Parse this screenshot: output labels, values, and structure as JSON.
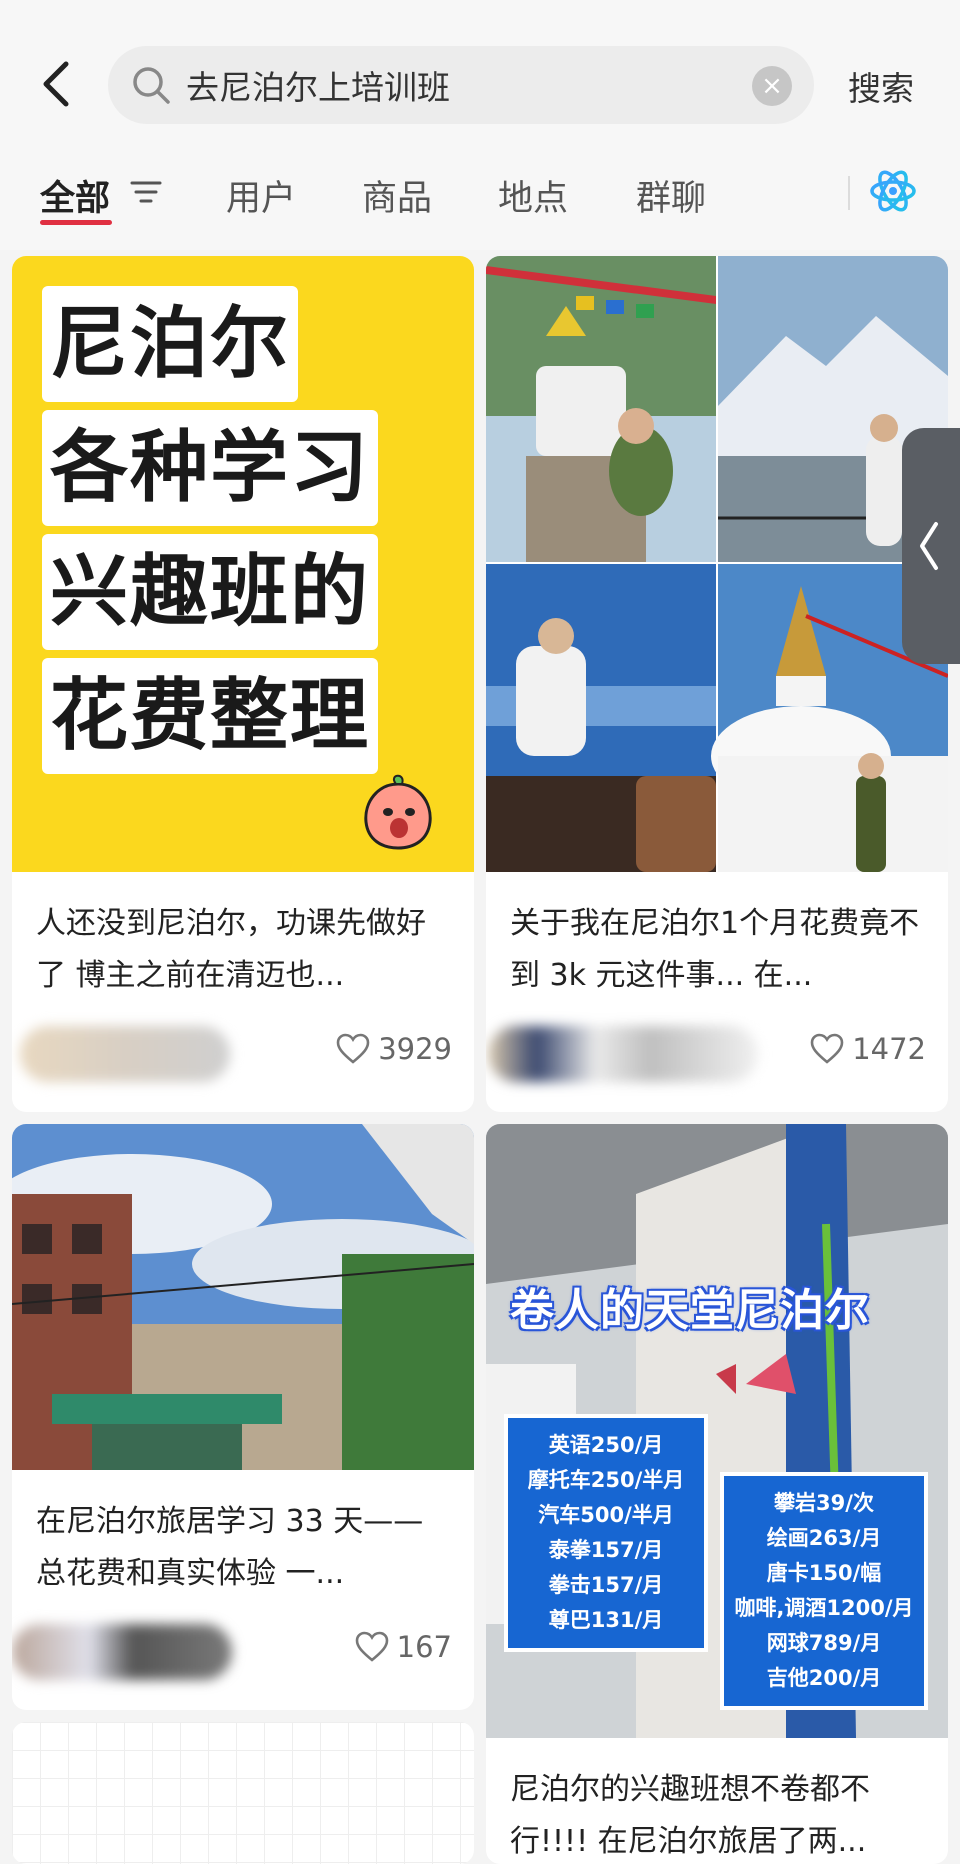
{
  "header": {
    "back_icon": "chevron-left-icon",
    "search": {
      "value": "去尼泊尔上培训班",
      "placeholder": "搜索"
    },
    "submit_label": "搜索"
  },
  "tabs": [
    {
      "label": "全部",
      "active": true
    },
    {
      "label": "用户"
    },
    {
      "label": "商品"
    },
    {
      "label": "地点"
    },
    {
      "label": "群聊"
    }
  ],
  "accent_color": "#e03042",
  "feed": [
    {
      "cover_lines": [
        "尼泊尔",
        "各种学习",
        "兴趣班的",
        "花费整理"
      ],
      "title": "人还没到尼泊尔，功课先做好了 博主之前在清迈也...",
      "likes": "3929"
    },
    {
      "title": "关于我在尼泊尔1个月花费竟不到 3k 元这件事... 在...",
      "likes": "1472"
    },
    {
      "title": "在尼泊尔旅居学习 33 天——总花费和真实体验 一...",
      "likes": "167"
    },
    {
      "cover_title": "卷人的天堂尼泊尔",
      "prices_left": [
        "英语250/月",
        "摩托车250/半月",
        "汽车500/半月",
        "泰拳157/月",
        "拳击157/月",
        "尊巴131/月"
      ],
      "prices_right": [
        "攀岩39/次",
        "绘画263/月",
        "唐卡150/幅",
        "咖啡,调酒1200/月",
        "网球789/月",
        "吉他200/月"
      ],
      "title": "尼泊尔的兴趣班想不卷都不行!!!! 在尼泊尔旅居了两..."
    }
  ]
}
